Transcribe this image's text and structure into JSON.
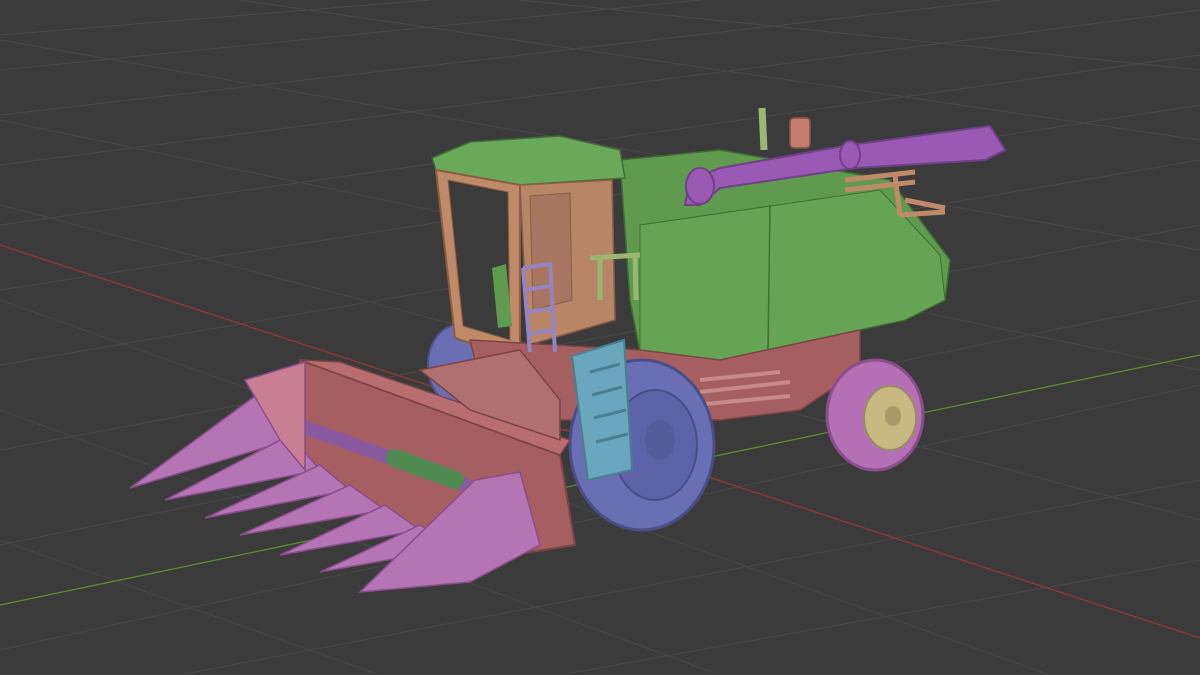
{
  "app": {
    "name": "3D viewport",
    "view": "perspective"
  },
  "scene": {
    "object": "combine-harvester",
    "shading": "solid-random-color",
    "grid_visible": true,
    "x_axis_visible": true,
    "y_axis_visible": true
  },
  "colors": {
    "background": "#3b3b3b",
    "grid_line": "#4a4a4a",
    "x_axis": "#8f3a3a",
    "y_axis": "#5c8a33",
    "cab_frame": "#c08a68",
    "body_green": "#5f9a4e",
    "header_pink": "#c87f93",
    "header_base": "#a55f61",
    "tines_purple": "#b574b4",
    "wheel_blue": "#6a6fb4",
    "ladder_teal": "#6aa6bd",
    "hub_tan": "#c8b882",
    "auger_pipe": "#9a5ab4",
    "rim_green": "#4f8a53"
  }
}
